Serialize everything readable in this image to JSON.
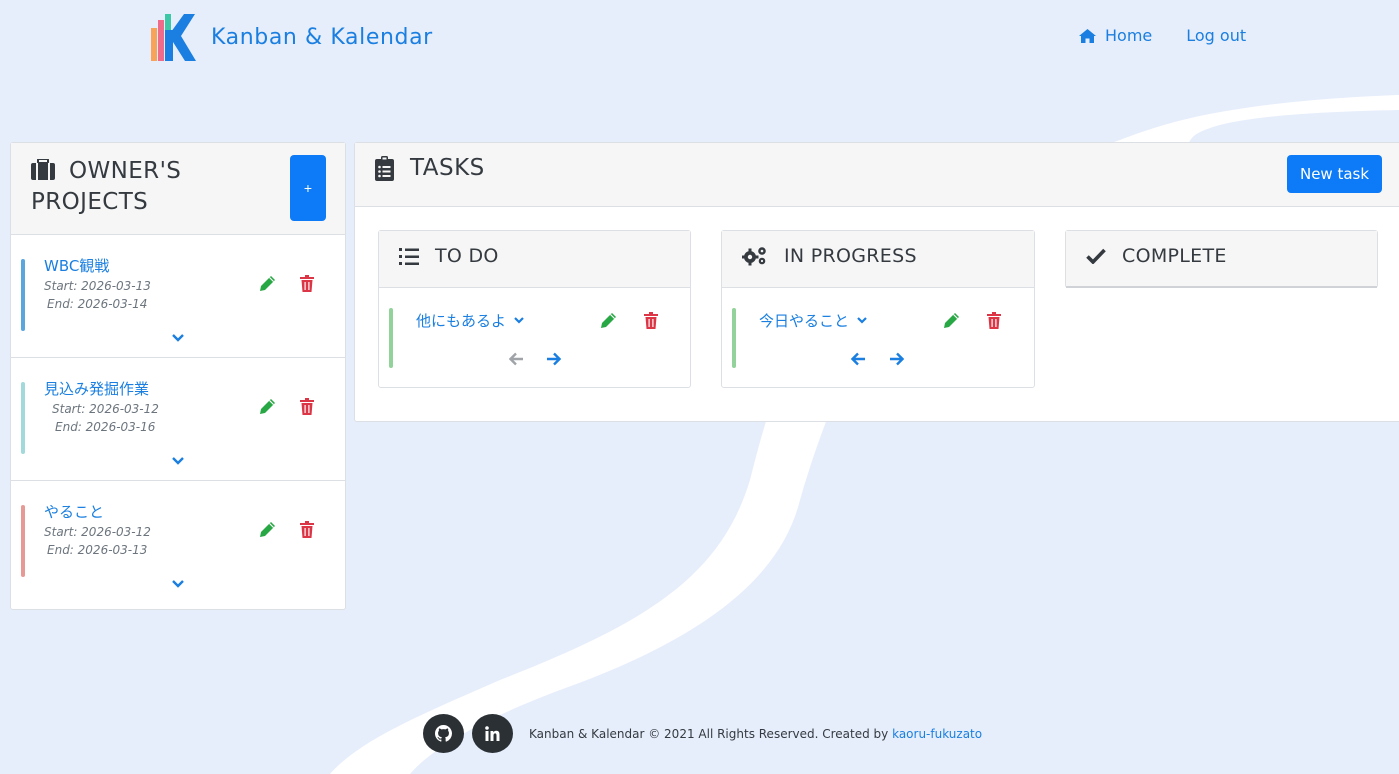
{
  "brand": {
    "name": "Kanban & Kalendar"
  },
  "nav": {
    "home": "Home",
    "logout": "Log out"
  },
  "projects": {
    "title": "OWNER'S PROJECTS",
    "add_label": "+",
    "items": [
      {
        "name": "WBC観戦",
        "start": "Start: 2026-03-13",
        "end": "End: 2026-03-14",
        "color": "#5aa6dd"
      },
      {
        "name": "見込み発掘作業",
        "start": "Start: 2026-03-12",
        "end": "End: 2026-03-16",
        "color": "#a4d9dc"
      },
      {
        "name": "やること",
        "start": "Start: 2026-03-12",
        "end": "End: 2026-03-13",
        "color": "#e69a96"
      }
    ]
  },
  "tasks": {
    "title": "TASKS",
    "new_task_label": "New task",
    "columns": [
      {
        "title": "TO DO",
        "icon": "list-icon",
        "items": [
          {
            "name": "他にもあるよ"
          }
        ]
      },
      {
        "title": "IN PROGRESS",
        "icon": "gears-icon",
        "items": [
          {
            "name": "今日やること"
          }
        ]
      },
      {
        "title": "COMPLETE",
        "icon": "check-icon",
        "items": []
      }
    ]
  },
  "footer": {
    "text": "Kanban & Kalendar © 2021 All Rights Reserved. Created by ",
    "author": "kaoru-fukuzato"
  },
  "colors": {
    "accent": "#0d7bf7",
    "link": "#1a7fe0",
    "edit": "#28a745",
    "delete": "#dc3545",
    "background": "#e7eefb"
  }
}
